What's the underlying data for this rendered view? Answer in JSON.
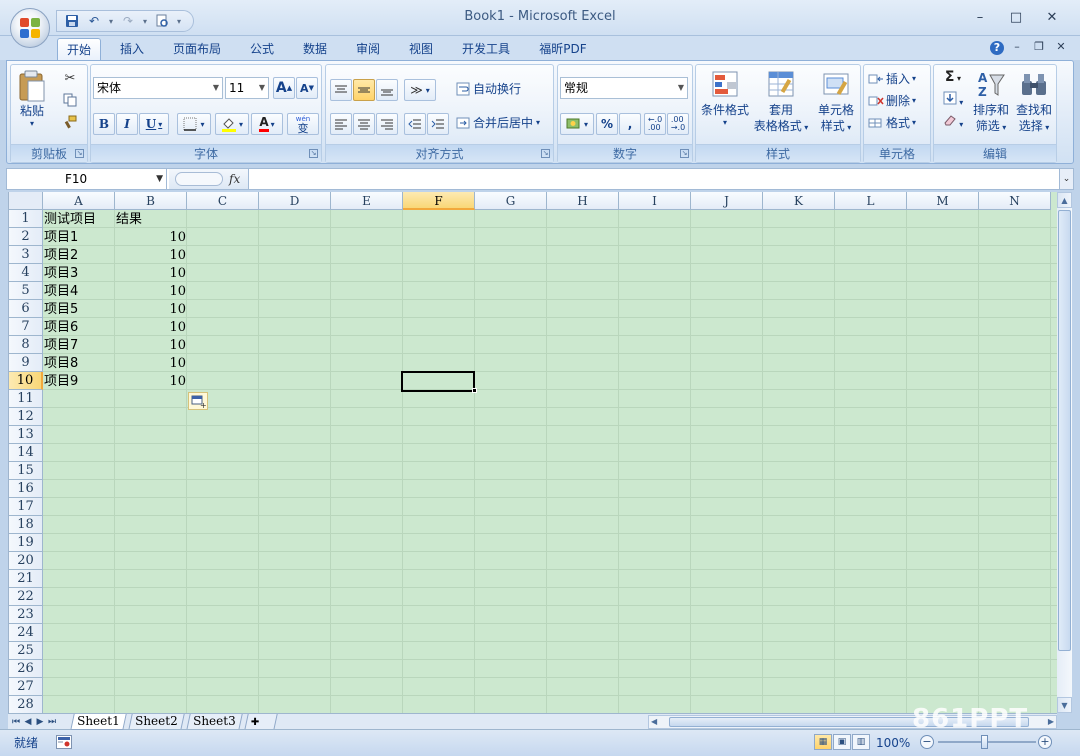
{
  "window": {
    "title": "Book1 - Microsoft Excel",
    "minimize": "–",
    "maximize": "□",
    "close": "✕"
  },
  "ribbon_controls": {
    "help": "?",
    "minimize": "–",
    "restore": "❐",
    "close": "✕"
  },
  "tabs": [
    {
      "label": "开始",
      "active": true
    },
    {
      "label": "插入"
    },
    {
      "label": "页面布局"
    },
    {
      "label": "公式"
    },
    {
      "label": "数据"
    },
    {
      "label": "审阅"
    },
    {
      "label": "视图"
    },
    {
      "label": "开发工具"
    },
    {
      "label": "福昕PDF"
    }
  ],
  "clipboard": {
    "paste": "粘贴",
    "group": "剪贴板"
  },
  "font": {
    "name": "宋体",
    "size": "11",
    "bold": "B",
    "italic": "I",
    "underline": "U",
    "group": "字体",
    "grow": "A",
    "shrink": "A",
    "color_a": "A",
    "wen": "变",
    "wen_top": "wén"
  },
  "alignment": {
    "wrap": "自动换行",
    "merge": "合并后居中",
    "group": "对齐方式"
  },
  "number": {
    "format": "常规",
    "percent": "%",
    "comma": ",",
    "inc_decimal": "←.0\n.00",
    "dec_decimal": ".00\n→.0",
    "group": "数字"
  },
  "styles": {
    "conditional": "条件格式",
    "table_format_1": "套用",
    "table_format_2": "表格格式",
    "cell_style_1": "单元格",
    "cell_style_2": "样式",
    "group": "样式"
  },
  "cells": {
    "insert": "插入",
    "delete": "删除",
    "format": "格式",
    "group": "单元格"
  },
  "editing": {
    "sort_1": "排序和",
    "sort_2": "筛选",
    "find_1": "查找和",
    "find_2": "选择",
    "sigma": "Σ",
    "group": "编辑"
  },
  "formula_bar": {
    "name_box": "F10",
    "fx": "fx",
    "value": ""
  },
  "columns": [
    "A",
    "B",
    "C",
    "D",
    "E",
    "F",
    "G",
    "H",
    "I",
    "J",
    "K",
    "L",
    "M",
    "N"
  ],
  "selected_column": "F",
  "rows": [
    "1",
    "2",
    "3",
    "4",
    "5",
    "6",
    "7",
    "8",
    "9",
    "10",
    "11",
    "12",
    "13",
    "14",
    "15",
    "16",
    "17",
    "18",
    "19",
    "20",
    "21",
    "22",
    "23",
    "24",
    "25",
    "26",
    "27",
    "28"
  ],
  "selected_row": "10",
  "grid": {
    "a1": "测试项目",
    "b1": "结果",
    "a2": "项目1",
    "b2": "10",
    "a3": "项目2",
    "b3": "10",
    "a4": "项目3",
    "b4": "10",
    "a5": "项目4",
    "b5": "10",
    "a6": "项目5",
    "b6": "10",
    "a7": "项目6",
    "b7": "10",
    "a8": "项目7",
    "b8": "10",
    "a9": "项目8",
    "b9": "10",
    "a10": "项目9",
    "b10": "10"
  },
  "sheets": [
    "Sheet1",
    "Sheet2",
    "Sheet3"
  ],
  "status": {
    "text": "就绪",
    "zoom": "100%",
    "zoom_out": "−",
    "zoom_in": "+"
  },
  "watermark": "861PPT",
  "colors": {
    "accent": "#15428b",
    "grid_bg": "#cce8cf",
    "selected_header": "#f9d777"
  }
}
